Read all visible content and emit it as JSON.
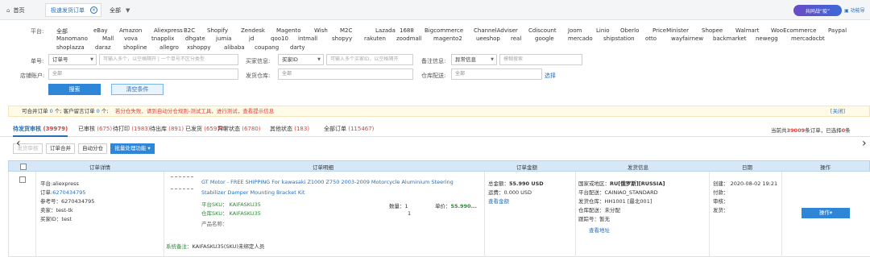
{
  "tabs": {
    "home": "首页",
    "active": "极速发货订单",
    "all": "全部"
  },
  "promo": "共同战“疫”",
  "feature": "功能导",
  "platform_label": "平台:",
  "platforms_row1": [
    "全部",
    "eBay",
    "Amazon",
    "Aliexpress",
    "B2C",
    "Shopify",
    "Zendesk",
    "Magento",
    "Wish",
    "M2C",
    "Lazada",
    "1688",
    "Bigcommerce",
    "ChannelAdviser",
    "Cdiscount",
    "Joom",
    "Linio",
    "Oberlo",
    "PriceMinister",
    "Shopee",
    "Walmart",
    "WooEcommerce",
    "Paypal"
  ],
  "platforms_row2": [
    "Manomano",
    "Mall",
    "vova",
    "tnapplix",
    "dhgate",
    "jumia",
    "jd",
    "qoo10",
    "intmall",
    "shopyy",
    "rakuten",
    "zoodmall",
    "magento2",
    "ueeshop",
    "real",
    "google",
    "mercado",
    "shipstation",
    "otto",
    "wayfairnew",
    "backmarket",
    "newegg",
    "mercadocbt"
  ],
  "platforms_row3": [
    "shoplazza",
    "daraz",
    "shopline",
    "allegro",
    "xshoppy",
    "alibaba",
    "coupang",
    "darty"
  ],
  "filters": {
    "order_label": "单号:",
    "order_select": "订单号",
    "order_placeholder": "可输入多个，以空格隔开 | 一个单号不区分类型",
    "buyer_label": "买家信息:",
    "buyer_select": "买家ID",
    "buyer_placeholder": "可输入多个买家ID，以空格隔开",
    "remark_label": "备注信息:",
    "remark_select": "异常信息",
    "remark_placeholder": "模糊搜索",
    "shop_label": "店铺账户:",
    "shop_value": "全部",
    "warehouse_label": "发货仓库:",
    "warehouse_value": "全部",
    "ship_label": "仓库配送:",
    "ship_value": "全部",
    "ship_extra": "选择"
  },
  "buttons": {
    "search": "搜索",
    "clear": "清空条件"
  },
  "notice": {
    "a": "可合并订单",
    "a_n": "0",
    "a_sep": "个;",
    "b": "客户留言订单",
    "b_n": "0",
    "b_sep": "个;",
    "warn": "若分仓失败、请到自动分仓规则-测试工具，进行测试，查看提示信息",
    "close": "[关闭]"
  },
  "status_tabs": [
    {
      "label": "待发货审核",
      "count": "(39979)"
    },
    {
      "label": "已审核",
      "count": "(675)"
    },
    {
      "label": "待打印",
      "count": "(1983)"
    },
    {
      "label": "待出库",
      "count": "(891)"
    },
    {
      "label": "已发货",
      "count": "(65976)"
    },
    {
      "label": "异常状态",
      "count": "(6780)"
    },
    {
      "label": "其他状态",
      "count": "(183)"
    },
    {
      "label": "全部订单",
      "count": "(115467)"
    }
  ],
  "total": {
    "prefix": "当前共",
    "n": "39009",
    "mid": "条订单，已选择",
    "sel": "0",
    "suffix": "条"
  },
  "actions": {
    "audit": "发货审核",
    "merge": "订单合并",
    "auto": "自动分仓",
    "batch": "批量处理功能"
  },
  "table_headers": [
    "订单详情",
    "订单明细",
    "订单金额",
    "发货信息",
    "日期",
    "操作"
  ],
  "order": {
    "platform": "平台:aliexpress",
    "order_label": "订单:",
    "order_no": "6270434795",
    "ref": "参考号：6270434795",
    "seller": "卖家：test-tk",
    "buyer": "买家ID：test",
    "product_title_1": "GT Motor - FREE SHIPPING For kawasaki Z1000 Z750 2003-2009 Motorcycle Aluminium Steering",
    "product_title_2": "Stabilizer Damper Mounting Bracket Kit",
    "platform_sku": "平台SKU：  KAIFASKU35",
    "warehouse_sku": "仓库SKU：  KAIFASKU35",
    "product_name": "产品名称：",
    "qty1": "数量：1",
    "qty2": "1",
    "unit_price_label": "单价：",
    "unit_price": "55.990...",
    "sys_remark_label": "系统备注：",
    "sys_remark": "KAIFASKU35(SKU)未绑定人员",
    "total_amount": "总金额：",
    "total_amount_v": "55.990 USD",
    "shipping_fee": "运费：0.000 USD",
    "view_amount": "查看金额",
    "country": "国家或地区：",
    "country_v": "RU[俄罗斯][RUSSIA]",
    "platform_ship": "平台配送：CAINIAO_STANDARD",
    "ship_wh": "发货仓库：HH1001 [最北001]",
    "wh_ship": "仓库配送：未分配",
    "tracking": "跟踪号：暂无",
    "view_address": "查看地址",
    "created": "创建：  2020-08-02 19:21",
    "paid": "付款：",
    "audit": "审核：",
    "shipped": "发货：",
    "op": "操作▾"
  }
}
